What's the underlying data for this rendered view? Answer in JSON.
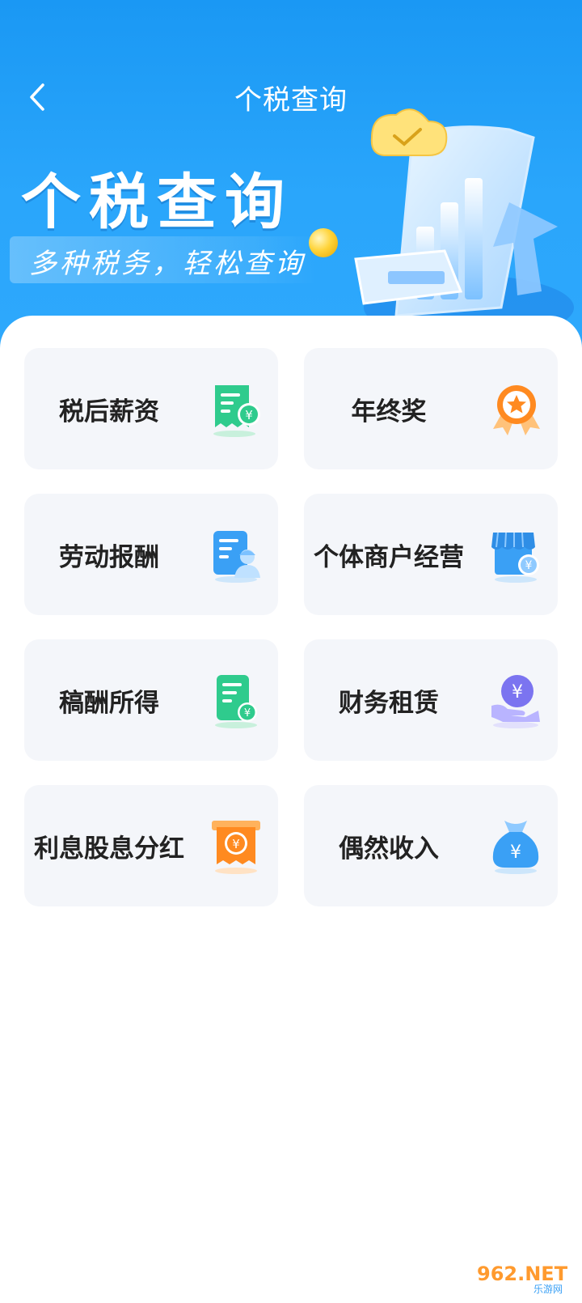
{
  "header": {
    "title": "个税查询",
    "back_icon": "chevron-left-icon"
  },
  "banner": {
    "title": "个税查询",
    "subtitle": "多种税务，轻松查询"
  },
  "categories": [
    {
      "label": "税后薪资",
      "icon": "salary-receipt-icon",
      "color": "#2fcb8d"
    },
    {
      "label": "年终奖",
      "icon": "medal-icon",
      "color": "#ff8a20"
    },
    {
      "label": "劳动报酬",
      "icon": "worker-document-icon",
      "color": "#3aa0f5"
    },
    {
      "label": "个体商户经营",
      "icon": "store-icon",
      "color": "#3aa0f5"
    },
    {
      "label": "稿酬所得",
      "icon": "manuscript-icon",
      "color": "#2fcb8d"
    },
    {
      "label": "财务租赁",
      "icon": "hand-coin-icon",
      "color": "#7b74f0"
    },
    {
      "label": "利息股息分红",
      "icon": "dividend-receipt-icon",
      "color": "#ff8a20"
    },
    {
      "label": "偶然收入",
      "icon": "money-bag-icon",
      "color": "#3aa0f5"
    }
  ],
  "watermark": {
    "text": "962.NET",
    "subtext": "乐游网"
  }
}
